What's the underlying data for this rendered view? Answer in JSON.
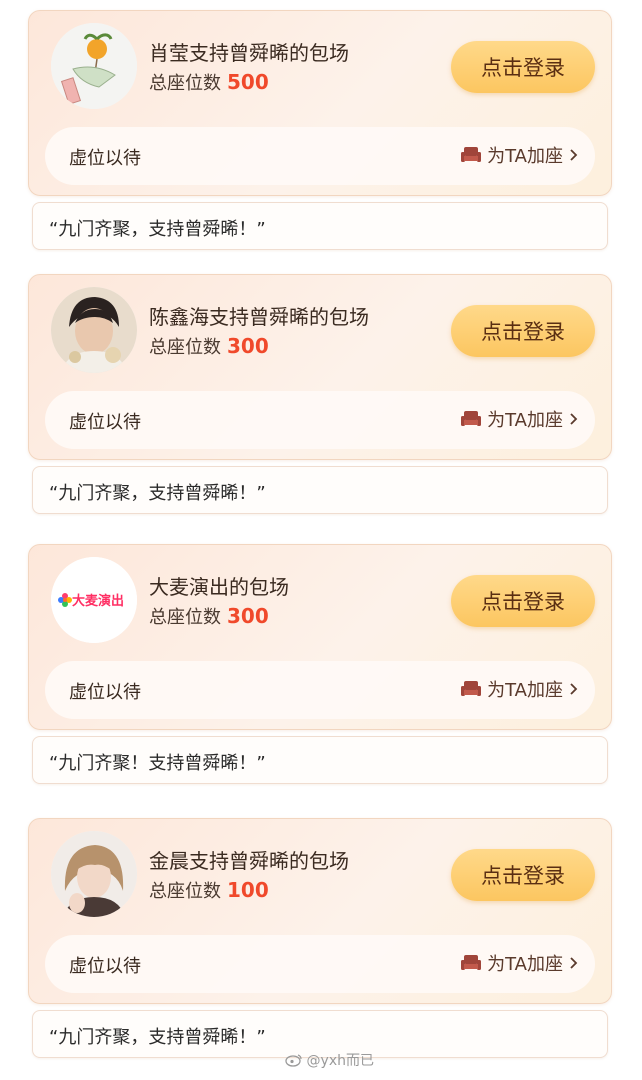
{
  "cards": [
    {
      "title": "肖莹支持曾舜晞的包场",
      "seats_label": "总座位数",
      "seats": "500",
      "login_label": "点击登录",
      "status": "虚位以待",
      "add_seat_label": "为TA加座",
      "quote": "“九门齐聚，支持曾舜晞！”",
      "avatar_icon": "wind-chime-icon"
    },
    {
      "title": "陈鑫海支持曾舜晞的包场",
      "seats_label": "总座位数",
      "seats": "300",
      "login_label": "点击登录",
      "status": "虚位以待",
      "add_seat_label": "为TA加座",
      "quote": "“九门齐聚，支持曾舜晞！”",
      "avatar_icon": "person-photo"
    },
    {
      "title": "大麦演出的包场",
      "seats_label": "总座位数",
      "seats": "300",
      "login_label": "点击登录",
      "status": "虚位以待",
      "add_seat_label": "为TA加座",
      "quote": "“九门齐聚！支持曾舜晞！”",
      "avatar_icon": "damai-logo",
      "logo_text": "大麦演出"
    },
    {
      "title": "金晨支持曾舜晞的包场",
      "seats_label": "总座位数",
      "seats": "100",
      "login_label": "点击登录",
      "status": "虚位以待",
      "add_seat_label": "为TA加座",
      "quote": "“九门齐聚，支持曾舜晞！”",
      "avatar_icon": "person-photo"
    }
  ],
  "watermark": "@yxh而已",
  "colors": {
    "accent_number": "#f0492b",
    "button_gold": "#fcc660",
    "card_border": "#f2d6c0"
  }
}
